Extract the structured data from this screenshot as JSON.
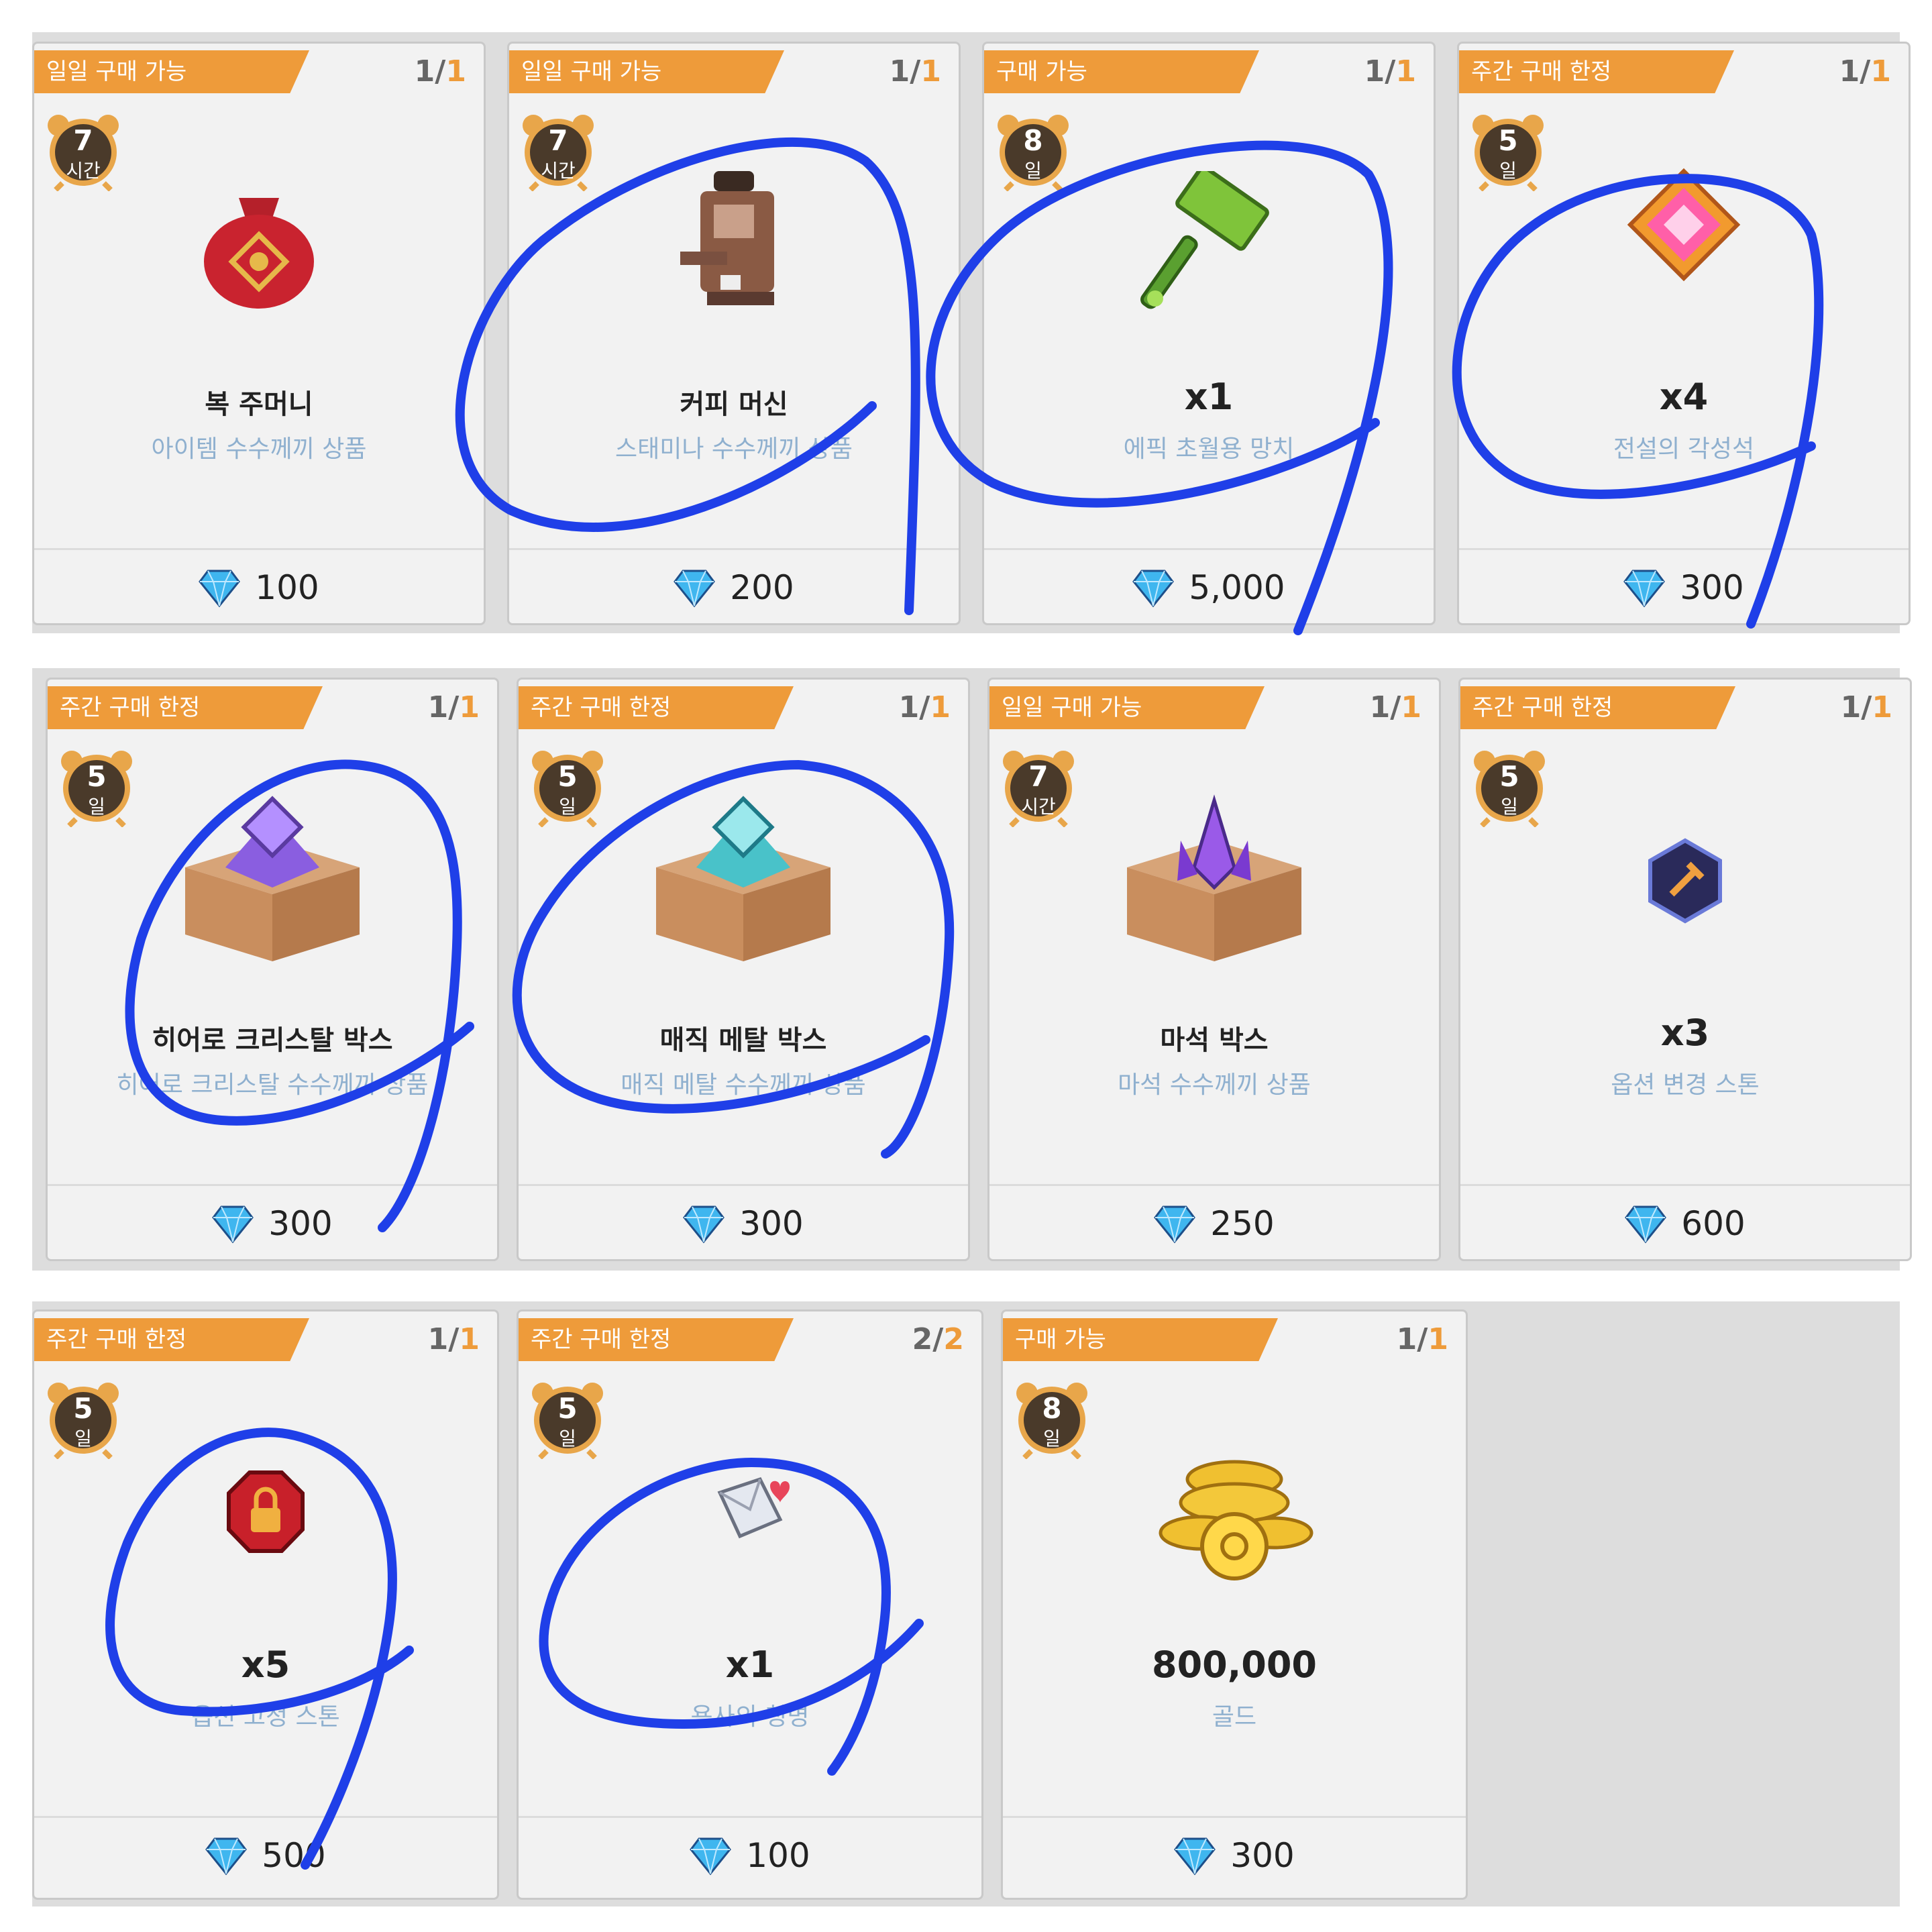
{
  "colors": {
    "tag_orange": "#ee9b3a",
    "timer_brown": "#4a3a2a",
    "gem_blue": "#3fb6ef",
    "desc_blue": "#8fb0cf",
    "scribble_blue": "#1f3fe8"
  },
  "rows": [
    [
      {
        "tag": "일일 구매 가능",
        "count_cur": "1",
        "count_max": "1",
        "timer_num": "7",
        "timer_unit": "시간",
        "icon": "lucky-pouch-icon",
        "name": "복 주머니",
        "desc": "아이템 수수께끼 상품",
        "price": "100"
      },
      {
        "tag": "일일 구매 가능",
        "count_cur": "1",
        "count_max": "1",
        "timer_num": "7",
        "timer_unit": "시간",
        "icon": "coffee-machine-icon",
        "name": "커피 머신",
        "desc": "스태미나 수수께끼 상품",
        "price": "200"
      },
      {
        "tag": "구매 가능",
        "count_cur": "1",
        "count_max": "1",
        "timer_num": "8",
        "timer_unit": "일",
        "icon": "hammer-icon",
        "name": "x1",
        "desc": "에픽 초월용 망치",
        "price": "5,000"
      },
      {
        "tag": "주간 구매 한정",
        "count_cur": "1",
        "count_max": "1",
        "timer_num": "5",
        "timer_unit": "일",
        "icon": "awakening-stone-icon",
        "name": "x4",
        "desc": "전설의 각성석",
        "price": "300"
      }
    ],
    [
      {
        "tag": "주간 구매 한정",
        "count_cur": "1",
        "count_max": "1",
        "timer_num": "5",
        "timer_unit": "일",
        "icon": "hero-crystal-box-icon",
        "name": "히어로 크리스탈 박스",
        "desc": "히어로 크리스탈 수수께끼 상품",
        "price": "300"
      },
      {
        "tag": "주간 구매 한정",
        "count_cur": "1",
        "count_max": "1",
        "timer_num": "5",
        "timer_unit": "일",
        "icon": "magic-metal-box-icon",
        "name": "매직 메탈 박스",
        "desc": "매직 메탈 수수께끼 상품",
        "price": "300"
      },
      {
        "tag": "일일 구매 가능",
        "count_cur": "1",
        "count_max": "1",
        "timer_num": "7",
        "timer_unit": "시간",
        "icon": "magic-stone-box-icon",
        "name": "마석 박스",
        "desc": "마석 수수께끼 상품",
        "price": "250"
      },
      {
        "tag": "주간 구매 한정",
        "count_cur": "1",
        "count_max": "1",
        "timer_num": "5",
        "timer_unit": "일",
        "icon": "option-change-stone-icon",
        "name": "x3",
        "desc": "옵션 변경 스톤",
        "price": "600"
      }
    ],
    [
      {
        "tag": "주간 구매 한정",
        "count_cur": "1",
        "count_max": "1",
        "timer_num": "5",
        "timer_unit": "일",
        "icon": "option-lock-stone-icon",
        "name": "x5",
        "desc": "옵션 고정 스톤",
        "price": "500"
      },
      {
        "tag": "주간 구매 한정",
        "count_cur": "2",
        "count_max": "2",
        "timer_num": "5",
        "timer_unit": "일",
        "icon": "title-letter-icon",
        "name": "x1",
        "desc": "용사의 칭명",
        "price": "100"
      },
      {
        "tag": "구매 가능",
        "count_cur": "1",
        "count_max": "1",
        "timer_num": "8",
        "timer_unit": "일",
        "icon": "gold-coins-icon",
        "name": "800,000",
        "desc": "골드",
        "price": "300"
      }
    ]
  ]
}
